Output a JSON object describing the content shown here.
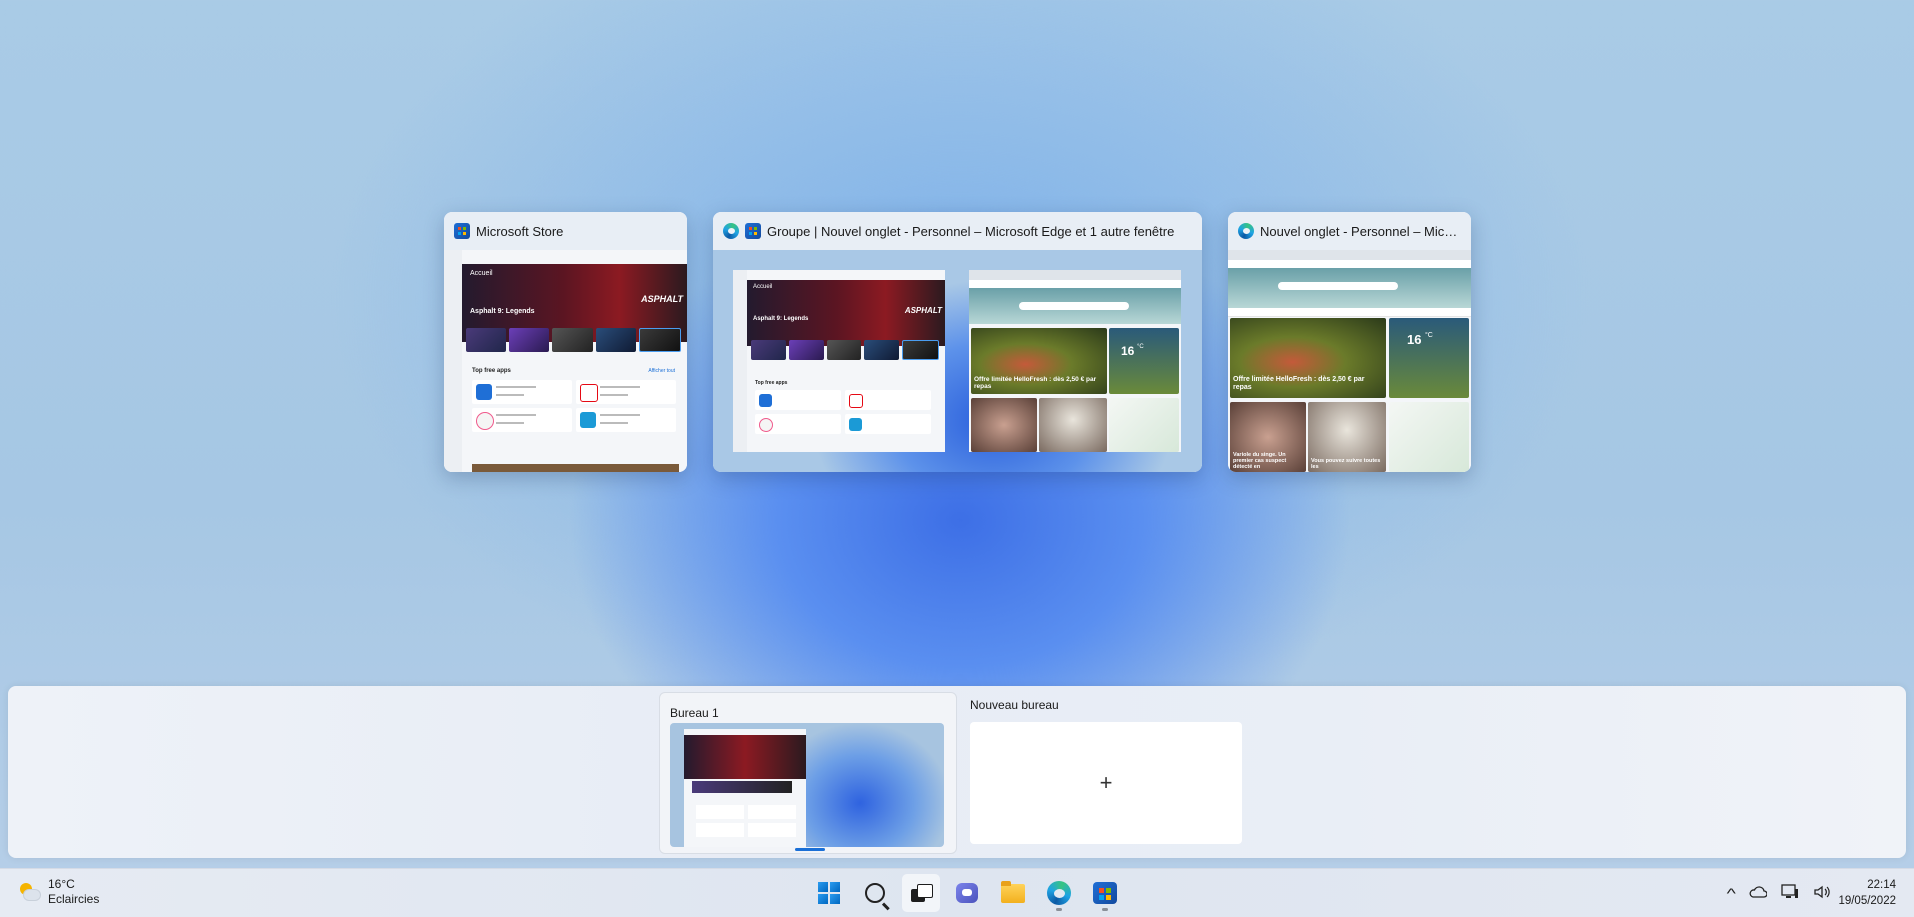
{
  "windows": [
    {
      "title": "Microsoft Store"
    },
    {
      "title": "Groupe | Nouvel onglet - Personnel – Microsoft Edge et 1 autre fenêtre"
    },
    {
      "title": "Nouvel onglet - Personnel – Micro..."
    }
  ],
  "store_preview": {
    "home": "Accueil",
    "hero_title": "Asphalt 9: Legends",
    "brand": "ASPHALT",
    "top_free": "Top free apps",
    "see_all": "Afficher tout"
  },
  "edge_preview": {
    "headline": "Offre limitée HelloFresh : dès 2,50 € par repas",
    "temp": "16",
    "temp_unit": "°C",
    "caption_left": "Variole du singe. Un premier cas suspect détecté en",
    "caption_right": "Vous pouvez suivre toutes les"
  },
  "desktops": [
    {
      "label": "Bureau 1"
    },
    {
      "label": "Nouveau bureau",
      "symbol": "+"
    }
  ],
  "taskbar": {
    "weather_temp": "16°C",
    "weather_desc": "Eclaircies",
    "time": "22:14",
    "date": "19/05/2022",
    "tray_chevron": "^"
  },
  "colors": {
    "accent": "#1a6fd6",
    "taskbar": "#e3e9f2"
  }
}
